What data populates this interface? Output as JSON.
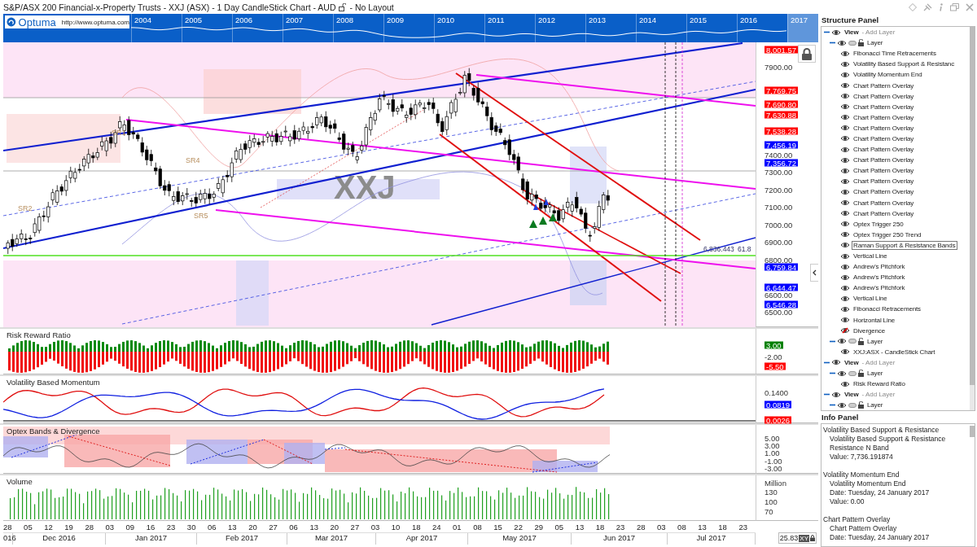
{
  "window": {
    "title": "S&P/ASX 200 Financial-x-Property Trusts - XXJ (ASX) - 1 Day CandleStick Chart - AUD",
    "layout": "- No Layout"
  },
  "overview": {
    "logo": "Optuma",
    "url": "http://www.optuma.com",
    "years": [
      "2004",
      "2005",
      "2006",
      "2007",
      "2008",
      "2009",
      "2010",
      "2011",
      "2012",
      "2013",
      "2014",
      "2015",
      "2016",
      "2017"
    ]
  },
  "price_chart": {
    "symbol": "XXJ",
    "annotations": [
      "SR1",
      "SR2",
      "SR4",
      "SR5"
    ],
    "level_label": "6,836.443",
    "level_pct": "61.8",
    "ticks": [
      "7900.00",
      "7400.00",
      "7300.00",
      "7200.00",
      "7100.00",
      "7000.00",
      "6900.00",
      "6800.00",
      "6600.00",
      "6500.00"
    ],
    "tags": [
      {
        "value": "8,001.57",
        "color": "#ff0000"
      },
      {
        "value": "7,769.75",
        "color": "#ff0000"
      },
      {
        "value": "7,690.80",
        "color": "#ff0000"
      },
      {
        "value": "7,630.88",
        "color": "#ff0000"
      },
      {
        "value": "7,538.28",
        "color": "#ff0000"
      },
      {
        "value": "7,456.19",
        "color": "#0000ff"
      },
      {
        "value": "7,356.72",
        "color": "#0000ff"
      },
      {
        "value": "6,759.84",
        "color": "#0000ff"
      },
      {
        "value": "6,644.47",
        "color": "#0000ff"
      },
      {
        "value": "6,546.28",
        "color": "#0000ff"
      }
    ]
  },
  "panes": [
    {
      "title": "Risk Reward Ratio",
      "kind": "bars",
      "ticks": [
        "-2.00"
      ],
      "tags": [
        {
          "value": "3.00",
          "color": "#008000"
        },
        {
          "value": "-5.50",
          "color": "#ff0000"
        }
      ]
    },
    {
      "title": "Volatility Based Momentum",
      "kind": "lines",
      "ticks": [
        "0.1400"
      ],
      "tags": [
        {
          "value": "0.0819",
          "color": "#0000ff"
        },
        {
          "value": "0.0026",
          "color": "#ff0000"
        }
      ]
    },
    {
      "title": "Optex Bands & Divergence",
      "kind": "bands",
      "ticks": [
        "5.00",
        "3.00",
        "1.00",
        "-1.00",
        "-3.00"
      ]
    },
    {
      "title": "Volume",
      "kind": "volume",
      "unit": "Million",
      "ticks": [
        "130",
        "100",
        "70"
      ]
    }
  ],
  "date_axis": {
    "days": [
      "28",
      "05",
      "12",
      "19",
      "28",
      "03",
      "09",
      "16",
      "23",
      "30",
      "06",
      "13",
      "20",
      "27",
      "06",
      "13",
      "20",
      "27",
      "03",
      "10",
      "18",
      "24",
      "01",
      "08",
      "15",
      "22",
      "29",
      "05",
      "13",
      "18",
      "23",
      "28",
      "03",
      "08",
      "13",
      "18",
      "23"
    ],
    "months": [
      "016",
      "Dec 2016",
      "Jan 2017",
      "Feb 2017",
      "Mar 2017",
      "Apr 2017",
      "May 2017",
      "Jun 2017",
      "Jul 2017"
    ]
  },
  "cursor_readout": {
    "value": "25.83",
    "mode": "XY"
  },
  "structure_panel": {
    "title": "Structure Panel",
    "tree": [
      {
        "kind": "view",
        "label": "View",
        "suffix": "- Add Layer",
        "expanded": true,
        "visible": true,
        "children": [
          {
            "kind": "layer",
            "label": "Layer",
            "expanded": true,
            "visible": true,
            "children": [
              {
                "kind": "item",
                "label": "Fibonacci Time Retracements",
                "visible": true,
                "selected": false
              },
              {
                "kind": "item",
                "label": "Volatility Based Support & Resistanc",
                "visible": true,
                "selected": false
              },
              {
                "kind": "item",
                "label": "Volatility Momentum End",
                "visible": true,
                "selected": false
              },
              {
                "kind": "item",
                "label": "Chart Pattern Overlay",
                "visible": true,
                "selected": false
              },
              {
                "kind": "item",
                "label": "Chart Pattern Overlay",
                "visible": true,
                "selected": false
              },
              {
                "kind": "item",
                "label": "Chart Pattern Overlay",
                "visible": true,
                "selected": false
              },
              {
                "kind": "item",
                "label": "Chart Pattern Overlay",
                "visible": true,
                "selected": false
              },
              {
                "kind": "item",
                "label": "Chart Pattern Overlay",
                "visible": true,
                "selected": false
              },
              {
                "kind": "item",
                "label": "Chart Pattern Overlay",
                "visible": true,
                "selected": false
              },
              {
                "kind": "item",
                "label": "Chart Pattern Overlay",
                "visible": true,
                "selected": false
              },
              {
                "kind": "item",
                "label": "Chart Pattern Overlay",
                "visible": true,
                "selected": false
              },
              {
                "kind": "item",
                "label": "Chart Pattern Overlay",
                "visible": true,
                "selected": false
              },
              {
                "kind": "item",
                "label": "Chart Pattern Overlay",
                "visible": true,
                "selected": false
              },
              {
                "kind": "item",
                "label": "Chart Pattern Overlay",
                "visible": true,
                "selected": false
              },
              {
                "kind": "item",
                "label": "Chart Pattern Overlay",
                "visible": true,
                "selected": false
              },
              {
                "kind": "item",
                "label": "Chart Pattern Overlay",
                "visible": true,
                "selected": false
              },
              {
                "kind": "item",
                "label": "Optex Trigger 250",
                "visible": true,
                "selected": false
              },
              {
                "kind": "item",
                "label": "Optex Trigger 250 Trend",
                "visible": true,
                "selected": false
              },
              {
                "kind": "item",
                "label": "Raman Support & Resistance Bands",
                "visible": true,
                "selected": true
              },
              {
                "kind": "item",
                "label": "Vertical Line",
                "visible": true,
                "selected": false
              },
              {
                "kind": "item",
                "label": "Andrew's Pitchfork",
                "visible": true,
                "selected": false
              },
              {
                "kind": "item",
                "label": "Andrew's Pitchfork",
                "visible": true,
                "selected": false
              },
              {
                "kind": "item",
                "label": "Andrew's Pitchfork",
                "visible": true,
                "selected": false
              },
              {
                "kind": "item",
                "label": "Vertical Line",
                "visible": true,
                "selected": false
              },
              {
                "kind": "item",
                "label": "Fibonacci Retracements",
                "visible": true,
                "selected": false
              },
              {
                "kind": "item",
                "label": "Horizontal Line",
                "visible": true,
                "selected": false
              },
              {
                "kind": "item",
                "label": "Divergence",
                "visible": false,
                "selected": false
              }
            ]
          },
          {
            "kind": "layer",
            "label": "Layer",
            "expanded": true,
            "visible": true,
            "children": [
              {
                "kind": "item",
                "label": "XXJ:ASX - CandleStick Chart",
                "visible": true,
                "selected": false
              }
            ]
          }
        ]
      },
      {
        "kind": "view",
        "label": "View",
        "suffix": "- Add Layer",
        "expanded": true,
        "visible": true,
        "children": [
          {
            "kind": "layer",
            "label": "Layer",
            "expanded": true,
            "visible": true,
            "children": [
              {
                "kind": "item",
                "label": "Risk Reward Ratio",
                "visible": true,
                "selected": false
              }
            ]
          }
        ]
      },
      {
        "kind": "view",
        "label": "View",
        "suffix": "- Add Layer",
        "expanded": true,
        "visible": true,
        "children": [
          {
            "kind": "layer",
            "label": "Layer",
            "expanded": true,
            "visible": true
          }
        ]
      }
    ]
  },
  "info_panel": {
    "title": "Info Panel",
    "groups": [
      {
        "title": "Volatility Based Support & Resistance",
        "lines": [
          "Volatility Based Support & Resistance",
          "Resistance N Band",
          "Value: 7,736.191874"
        ]
      },
      {
        "title": "Volatility Momentum End",
        "lines": [
          "Volatility Momentum End",
          "Date: Tuesday, 24 January 2017",
          "Value: 0.00"
        ]
      },
      {
        "title": "Chart Pattern Overlay",
        "lines": [
          "Chart Pattern Overlay",
          "Date: Tuesday, 24 January 2017"
        ]
      }
    ]
  }
}
